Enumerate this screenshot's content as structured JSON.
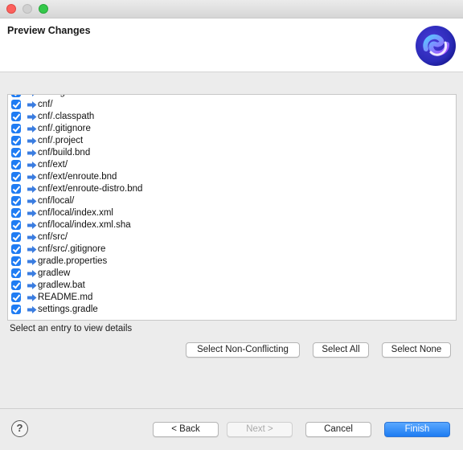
{
  "window": {
    "title": "",
    "header_title": "Preview Changes"
  },
  "files": [
    "build.gradle",
    "cnf/",
    "cnf/.classpath",
    "cnf/.gitignore",
    "cnf/.project",
    "cnf/build.bnd",
    "cnf/ext/",
    "cnf/ext/enroute.bnd",
    "cnf/ext/enroute-distro.bnd",
    "cnf/local/",
    "cnf/local/index.xml",
    "cnf/local/index.xml.sha",
    "cnf/src/",
    "cnf/src/.gitignore",
    "gradle.properties",
    "gradlew",
    "gradlew.bat",
    "README.md",
    "settings.gradle"
  ],
  "details_hint": "Select an entry to view details",
  "selection_buttons": {
    "non_conflicting": "Select Non-Conflicting",
    "all": "Select All",
    "none": "Select None"
  },
  "nav_buttons": {
    "back": "< Back",
    "next": "Next >",
    "cancel": "Cancel",
    "finish": "Finish"
  },
  "help_symbol": "?",
  "colors": {
    "accent": "#1f7cf3",
    "arrow": "#3b7de0"
  }
}
